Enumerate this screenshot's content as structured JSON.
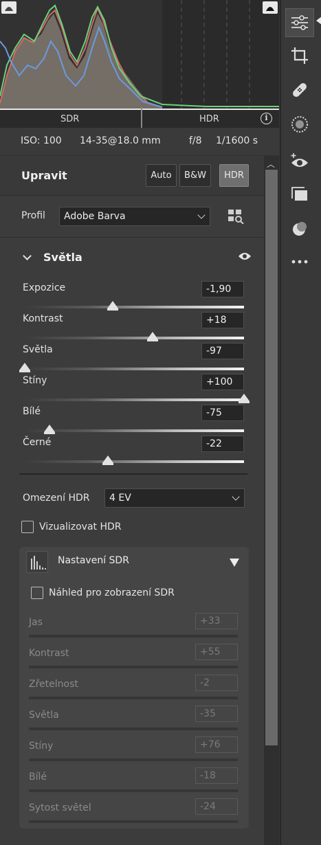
{
  "histogram": {
    "sdr_label": "SDR",
    "hdr_label": "HDR",
    "info_label": "i"
  },
  "exif": {
    "iso": "ISO: 100",
    "lens": "14-35@18.0 mm",
    "aperture": "f/8",
    "shutter": "1/1600 s"
  },
  "edit": {
    "title": "Upravit",
    "buttons": {
      "auto": "Auto",
      "bw": "B&W",
      "hdr": "HDR"
    }
  },
  "profile": {
    "label": "Profil",
    "value": "Adobe Barva"
  },
  "light": {
    "title": "Světla",
    "sliders": [
      {
        "label": "Expozice",
        "value": "-1,90",
        "pos": 0.41
      },
      {
        "label": "Kontrast",
        "value": "+18",
        "pos": 0.59
      },
      {
        "label": "Světla",
        "value": "-97",
        "pos": 0.015
      },
      {
        "label": "Stíny",
        "value": "+100",
        "pos": 1.0
      },
      {
        "label": "Bílé",
        "value": "-75",
        "pos": 0.125
      },
      {
        "label": "Černé",
        "value": "-22",
        "pos": 0.39
      }
    ]
  },
  "hdr_limit": {
    "label": "Omezení HDR",
    "value": "4 EV"
  },
  "visualize_hdr": "Vizualizovat HDR",
  "sdr_settings": {
    "title": "Nastavení SDR",
    "preview_label": "Náhled pro zobrazení SDR",
    "sliders": [
      {
        "label": "Jas",
        "value": "+33"
      },
      {
        "label": "Kontrast",
        "value": "+55"
      },
      {
        "label": "Zřetelnost",
        "value": "-2"
      },
      {
        "label": "Světla",
        "value": "-35"
      },
      {
        "label": "Stíny",
        "value": "+76"
      },
      {
        "label": "Bílé",
        "value": "-18"
      },
      {
        "label": "Sytost světel",
        "value": "-24"
      }
    ]
  },
  "tools": [
    "sliders-icon",
    "crop-icon",
    "heal-icon",
    "mask-icon",
    "redeye-icon",
    "presets-icon",
    "blend-icon",
    "more-icon"
  ]
}
